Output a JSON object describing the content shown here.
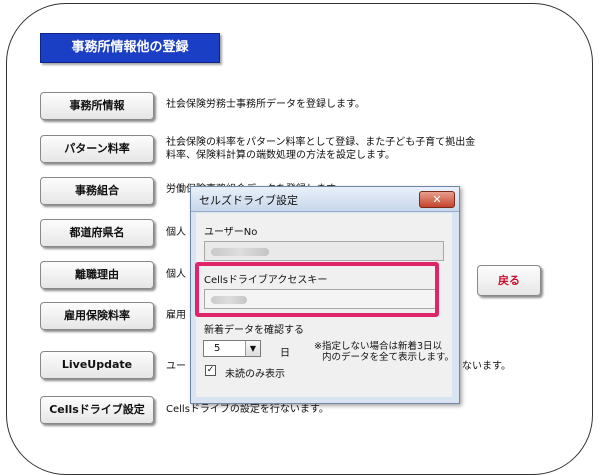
{
  "header": {
    "title": "事務所情報他の登録"
  },
  "menu": [
    {
      "label": "事務所情報",
      "desc": "社会保険労務士事務所データを登録します。"
    },
    {
      "label": "パターン料率",
      "desc": "社会保険の料率をパターン料率として登録、また子ども子育て拠出金",
      "desc2": "料率、保険料計算の端数処理の方法を設定します。"
    },
    {
      "label": "事務組合",
      "desc": "労働保険事務組合データを登録します。"
    },
    {
      "label": "都道府県名",
      "desc": "個人"
    },
    {
      "label": "離職理由",
      "desc": "個人"
    },
    {
      "label": "雇用保険料率",
      "desc": "雇用"
    },
    {
      "label": "LiveUpdate",
      "desc": "ユー",
      "desc_tail": "ないます。"
    },
    {
      "label": "Cellsドライブ設定",
      "desc": "Cellsドライブの設定を行ないます。"
    }
  ],
  "back_button": {
    "label": "戻る"
  },
  "dialog": {
    "title": "セルズドライブ設定",
    "close_glyph": "✕",
    "user_label": "ユーザーNo",
    "access_key_label": "Cellsドライブアクセスキー",
    "days_label": "新着データを確認する",
    "days_value": "5",
    "days_unit": "日",
    "note_line1": "※指定しない場合は新着3日以",
    "note_line2": "内のデータを全て表示します。",
    "unread_label": "未読のみ表示",
    "check_glyph": "✓",
    "dropdown_glyph": "▼"
  },
  "colors": {
    "banner": "#1a3fc4",
    "highlight": "#e0246a",
    "back_text": "#c8102e"
  }
}
